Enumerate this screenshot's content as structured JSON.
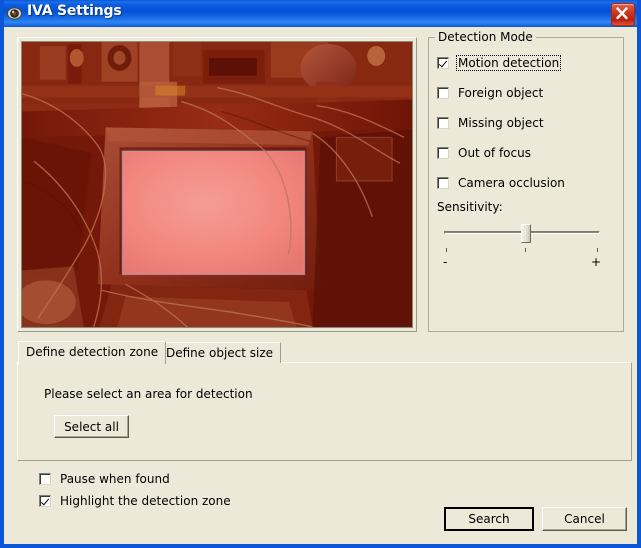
{
  "window": {
    "title": "IVA Settings",
    "title_icon": "camera-lens-icon",
    "close_icon": "close-icon",
    "accent_color": "#0a56d6",
    "face_color": "#ece9d8"
  },
  "preview": {
    "name": "video-preview",
    "description": "Red-tinted live camera view of a desk with a CRT monitor; the monitor screen area is highlighted as the detection zone",
    "tint_color": "#8a1d06",
    "zone_color": "#ff8a85"
  },
  "detection_mode": {
    "title": "Detection Mode",
    "options": [
      {
        "label": "Motion detection",
        "checked": true,
        "focused": true
      },
      {
        "label": "Foreign object",
        "checked": false,
        "focused": false
      },
      {
        "label": "Missing object",
        "checked": false,
        "focused": false
      },
      {
        "label": "Out of focus",
        "checked": false,
        "focused": false
      },
      {
        "label": "Camera occlusion",
        "checked": false,
        "focused": false
      }
    ],
    "sensitivity": {
      "label": "Sensitivity:",
      "min_label": "-",
      "max_label": "+",
      "value": 50,
      "min": 0,
      "max": 100,
      "ticks": [
        0,
        50,
        100
      ]
    }
  },
  "tabs": {
    "items": [
      {
        "label": "Define detection zone",
        "active": true
      },
      {
        "label": "Define object size",
        "active": false
      }
    ],
    "panel": {
      "instruction": "Please select an area for detection",
      "select_all_label": "Select all"
    }
  },
  "footer": {
    "options": [
      {
        "label": "Pause when found",
        "checked": false
      },
      {
        "label": "Highlight the detection zone",
        "checked": true
      }
    ],
    "search_label": "Search",
    "cancel_label": "Cancel"
  }
}
